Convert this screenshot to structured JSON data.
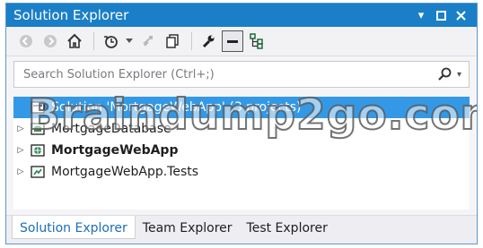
{
  "window": {
    "title": "Solution Explorer"
  },
  "search": {
    "placeholder": "Search Solution Explorer (Ctrl+;)"
  },
  "tree": {
    "items": [
      {
        "label": "Solution 'MortgageWebApp' (3 projects)",
        "selected": true
      },
      {
        "label": "MortgageDatabase",
        "bold": false
      },
      {
        "label": "MortgageWebApp",
        "bold": true
      },
      {
        "label": "MortgageWebApp.Tests",
        "bold": false
      }
    ]
  },
  "tabs": [
    {
      "label": "Solution Explorer",
      "active": true
    },
    {
      "label": "Team Explorer",
      "active": false
    },
    {
      "label": "Test Explorer",
      "active": false
    }
  ],
  "watermark": {
    "text": "Braindump2go.com"
  },
  "colors": {
    "title_bar": "#1b7fc8",
    "selection": "#3399e6",
    "active_tab_text": "#1b6fb6"
  }
}
